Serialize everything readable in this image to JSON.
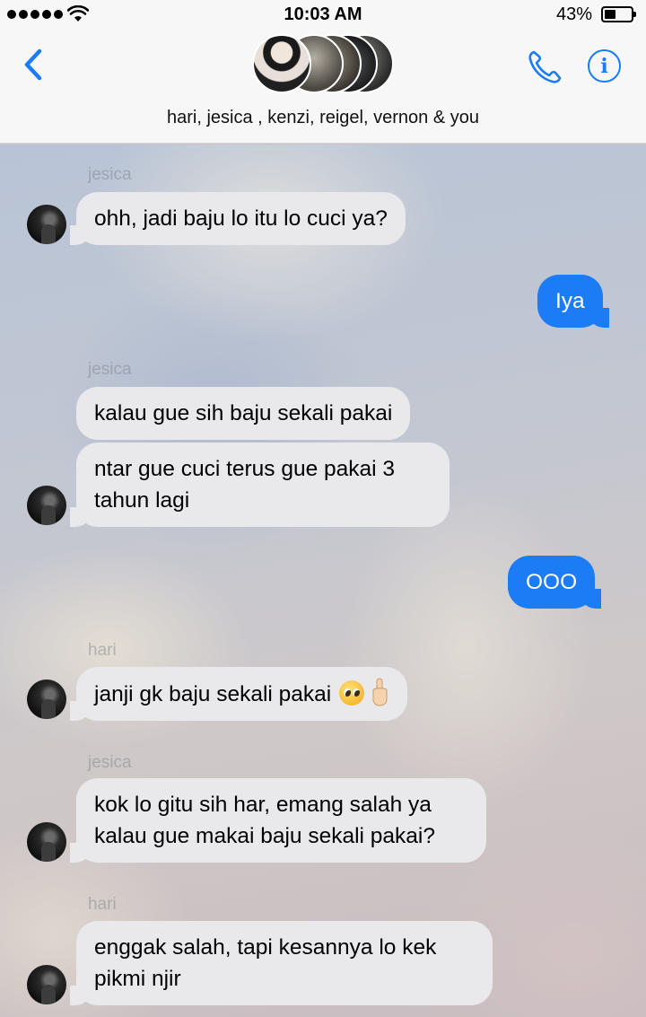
{
  "status_bar": {
    "time": "10:03 AM",
    "battery_percent": "43%",
    "battery_level": 0.43,
    "signal_icon": "signal-dots-icon",
    "wifi_icon": "wifi-icon"
  },
  "header": {
    "back_icon": "chevron-left-icon",
    "phone_icon": "phone-icon",
    "info_label": "i",
    "participants": "hari, jesica , kenzi, reigel, vernon & you"
  },
  "colors": {
    "accent": "#1b7cf5",
    "incoming_bubble": "#e9e9ec",
    "outgoing_bubble": "#1b7cf5"
  },
  "messages": [
    {
      "sender": "jesica",
      "direction": "incoming",
      "text": "ohh, jadi baju lo itu lo cuci ya?"
    },
    {
      "sender": "",
      "direction": "outgoing",
      "text": "Iya"
    },
    {
      "sender": "jesica",
      "direction": "incoming",
      "text": "kalau gue sih baju sekali pakai"
    },
    {
      "sender": "",
      "direction": "incoming",
      "text": "ntar gue cuci terus gue pakai 3 tahun lagi"
    },
    {
      "sender": "",
      "direction": "outgoing",
      "text": "OOO"
    },
    {
      "sender": "hari",
      "direction": "incoming",
      "text": "janji gk baju sekali pakai",
      "emoji": [
        "pleading-face-emoji",
        "index-up-emoji"
      ]
    },
    {
      "sender": "jesica",
      "direction": "incoming",
      "text": "kok lo gitu sih har, emang salah ya kalau gue makai baju sekali pakai?"
    },
    {
      "sender": "hari",
      "direction": "incoming",
      "text": "enggak salah, tapi kesannya lo kek pikmi njir"
    }
  ]
}
